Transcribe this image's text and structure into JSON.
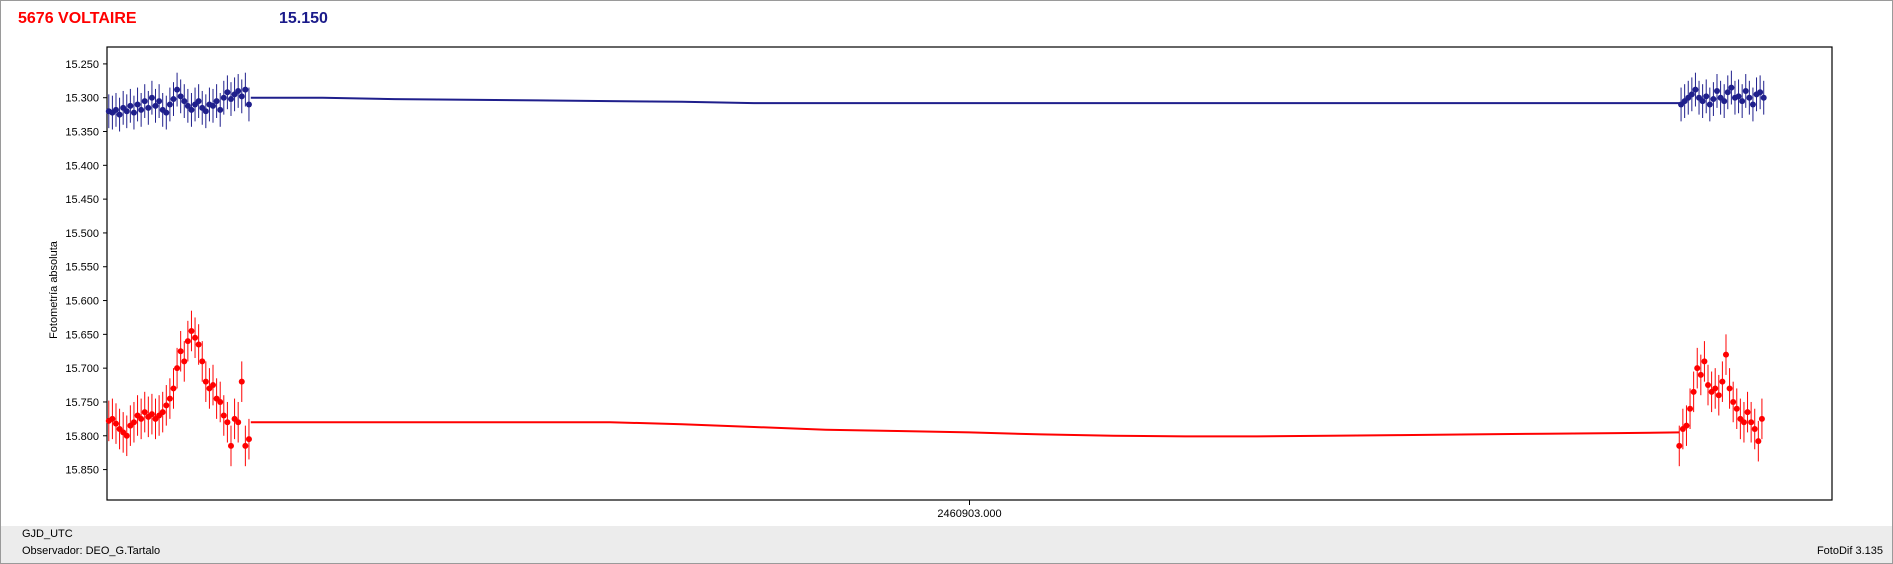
{
  "header": {
    "target_name": "5676 VOLTAIRE",
    "target_mag": "15.150"
  },
  "footer": {
    "x_axis_name": "GJD_UTC",
    "observer": "Observador: DEO_G.Tartalo",
    "software": "FotoDif 3.135"
  },
  "chart_data": {
    "type": "scatter",
    "ylabel": "Fotometría absoluta",
    "y_inverted": true,
    "ylim": [
      15.225,
      15.895
    ],
    "yticks": [
      "15.250",
      "15.300",
      "15.350",
      "15.400",
      "15.450",
      "15.500",
      "15.550",
      "15.600",
      "15.650",
      "15.700",
      "15.750",
      "15.800",
      "15.850"
    ],
    "x_label_text": "2460903.000",
    "x_center_tick": 2460903.0,
    "xlim_days": [
      2460902.52,
      2460903.48
    ],
    "grid": true,
    "series": [
      {
        "color": "#1f1f8c",
        "err": 0.025,
        "points_left": [
          [
            2460902.521,
            15.32
          ],
          [
            2460902.523,
            15.322
          ],
          [
            2460902.525,
            15.318
          ],
          [
            2460902.527,
            15.325
          ],
          [
            2460902.529,
            15.315
          ],
          [
            2460902.531,
            15.32
          ],
          [
            2460902.533,
            15.312
          ],
          [
            2460902.535,
            15.322
          ],
          [
            2460902.537,
            15.31
          ],
          [
            2460902.539,
            15.318
          ],
          [
            2460902.541,
            15.305
          ],
          [
            2460902.543,
            15.315
          ],
          [
            2460902.545,
            15.3
          ],
          [
            2460902.547,
            15.312
          ],
          [
            2460902.549,
            15.305
          ],
          [
            2460902.551,
            15.318
          ],
          [
            2460902.553,
            15.322
          ],
          [
            2460902.555,
            15.31
          ],
          [
            2460902.557,
            15.302
          ],
          [
            2460902.559,
            15.288
          ],
          [
            2460902.561,
            15.298
          ],
          [
            2460902.563,
            15.305
          ],
          [
            2460902.565,
            15.312
          ],
          [
            2460902.567,
            15.318
          ],
          [
            2460902.569,
            15.31
          ],
          [
            2460902.571,
            15.305
          ],
          [
            2460902.573,
            15.315
          ],
          [
            2460902.575,
            15.32
          ],
          [
            2460902.577,
            15.31
          ],
          [
            2460902.579,
            15.312
          ],
          [
            2460902.581,
            15.305
          ],
          [
            2460902.583,
            15.318
          ],
          [
            2460902.585,
            15.3
          ],
          [
            2460902.587,
            15.292
          ],
          [
            2460902.589,
            15.302
          ],
          [
            2460902.591,
            15.295
          ],
          [
            2460902.593,
            15.29
          ],
          [
            2460902.595,
            15.298
          ],
          [
            2460902.597,
            15.288
          ],
          [
            2460902.599,
            15.31
          ]
        ],
        "points_right": [
          [
            2460903.396,
            15.31
          ],
          [
            2460903.398,
            15.305
          ],
          [
            2460903.4,
            15.3
          ],
          [
            2460903.402,
            15.295
          ],
          [
            2460903.404,
            15.288
          ],
          [
            2460903.406,
            15.3
          ],
          [
            2460903.408,
            15.305
          ],
          [
            2460903.41,
            15.298
          ],
          [
            2460903.412,
            15.31
          ],
          [
            2460903.414,
            15.302
          ],
          [
            2460903.416,
            15.29
          ],
          [
            2460903.418,
            15.3
          ],
          [
            2460903.42,
            15.305
          ],
          [
            2460903.422,
            15.292
          ],
          [
            2460903.424,
            15.285
          ],
          [
            2460903.426,
            15.3
          ],
          [
            2460903.428,
            15.298
          ],
          [
            2460903.43,
            15.305
          ],
          [
            2460903.432,
            15.29
          ],
          [
            2460903.434,
            15.3
          ],
          [
            2460903.436,
            15.31
          ],
          [
            2460903.438,
            15.295
          ],
          [
            2460903.44,
            15.292
          ],
          [
            2460903.442,
            15.3
          ]
        ],
        "model": [
          [
            2460902.6,
            15.3
          ],
          [
            2460902.62,
            15.3
          ],
          [
            2460902.64,
            15.3
          ],
          [
            2460902.68,
            15.302
          ],
          [
            2460902.72,
            15.303
          ],
          [
            2460902.76,
            15.304
          ],
          [
            2460902.8,
            15.305
          ],
          [
            2460902.84,
            15.306
          ],
          [
            2460902.88,
            15.308
          ],
          [
            2460902.92,
            15.308
          ],
          [
            2460903.0,
            15.308
          ],
          [
            2460903.2,
            15.308
          ],
          [
            2460903.395,
            15.308
          ]
        ]
      },
      {
        "color": "#ff0000",
        "err": 0.03,
        "points_left": [
          [
            2460902.521,
            15.778
          ],
          [
            2460902.523,
            15.775
          ],
          [
            2460902.525,
            15.782
          ],
          [
            2460902.527,
            15.79
          ],
          [
            2460902.529,
            15.795
          ],
          [
            2460902.531,
            15.8
          ],
          [
            2460902.533,
            15.785
          ],
          [
            2460902.535,
            15.78
          ],
          [
            2460902.537,
            15.77
          ],
          [
            2460902.539,
            15.775
          ],
          [
            2460902.541,
            15.765
          ],
          [
            2460902.543,
            15.772
          ],
          [
            2460902.545,
            15.768
          ],
          [
            2460902.547,
            15.775
          ],
          [
            2460902.549,
            15.77
          ],
          [
            2460902.551,
            15.765
          ],
          [
            2460902.553,
            15.755
          ],
          [
            2460902.555,
            15.745
          ],
          [
            2460902.557,
            15.73
          ],
          [
            2460902.559,
            15.7
          ],
          [
            2460902.561,
            15.675
          ],
          [
            2460902.563,
            15.69
          ],
          [
            2460902.565,
            15.66
          ],
          [
            2460902.567,
            15.645
          ],
          [
            2460902.569,
            15.655
          ],
          [
            2460902.571,
            15.665
          ],
          [
            2460902.573,
            15.69
          ],
          [
            2460902.575,
            15.72
          ],
          [
            2460902.577,
            15.73
          ],
          [
            2460902.579,
            15.725
          ],
          [
            2460902.581,
            15.745
          ],
          [
            2460902.583,
            15.75
          ],
          [
            2460902.585,
            15.77
          ],
          [
            2460902.587,
            15.78
          ],
          [
            2460902.589,
            15.815
          ],
          [
            2460902.591,
            15.775
          ],
          [
            2460902.593,
            15.78
          ],
          [
            2460902.595,
            15.72
          ],
          [
            2460902.597,
            15.815
          ],
          [
            2460902.599,
            15.805
          ]
        ],
        "points_right": [
          [
            2460903.395,
            15.815
          ],
          [
            2460903.397,
            15.79
          ],
          [
            2460903.399,
            15.785
          ],
          [
            2460903.401,
            15.76
          ],
          [
            2460903.403,
            15.735
          ],
          [
            2460903.405,
            15.7
          ],
          [
            2460903.407,
            15.71
          ],
          [
            2460903.409,
            15.69
          ],
          [
            2460903.411,
            15.725
          ],
          [
            2460903.413,
            15.735
          ],
          [
            2460903.415,
            15.73
          ],
          [
            2460903.417,
            15.74
          ],
          [
            2460903.419,
            15.72
          ],
          [
            2460903.421,
            15.68
          ],
          [
            2460903.423,
            15.73
          ],
          [
            2460903.425,
            15.75
          ],
          [
            2460903.427,
            15.76
          ],
          [
            2460903.429,
            15.775
          ],
          [
            2460903.431,
            15.78
          ],
          [
            2460903.433,
            15.765
          ],
          [
            2460903.435,
            15.78
          ],
          [
            2460903.437,
            15.79
          ],
          [
            2460903.439,
            15.808
          ],
          [
            2460903.441,
            15.775
          ]
        ],
        "model": [
          [
            2460902.6,
            15.78
          ],
          [
            2460902.7,
            15.78
          ],
          [
            2460902.8,
            15.78
          ],
          [
            2460902.84,
            15.783
          ],
          [
            2460902.88,
            15.787
          ],
          [
            2460902.92,
            15.791
          ],
          [
            2460902.96,
            15.793
          ],
          [
            2460903.0,
            15.795
          ],
          [
            2460903.04,
            15.798
          ],
          [
            2460903.08,
            15.8
          ],
          [
            2460903.12,
            15.801
          ],
          [
            2460903.16,
            15.801
          ],
          [
            2460903.2,
            15.8
          ],
          [
            2460903.24,
            15.799
          ],
          [
            2460903.28,
            15.798
          ],
          [
            2460903.32,
            15.797
          ],
          [
            2460903.36,
            15.796
          ],
          [
            2460903.395,
            15.795
          ]
        ]
      }
    ]
  }
}
